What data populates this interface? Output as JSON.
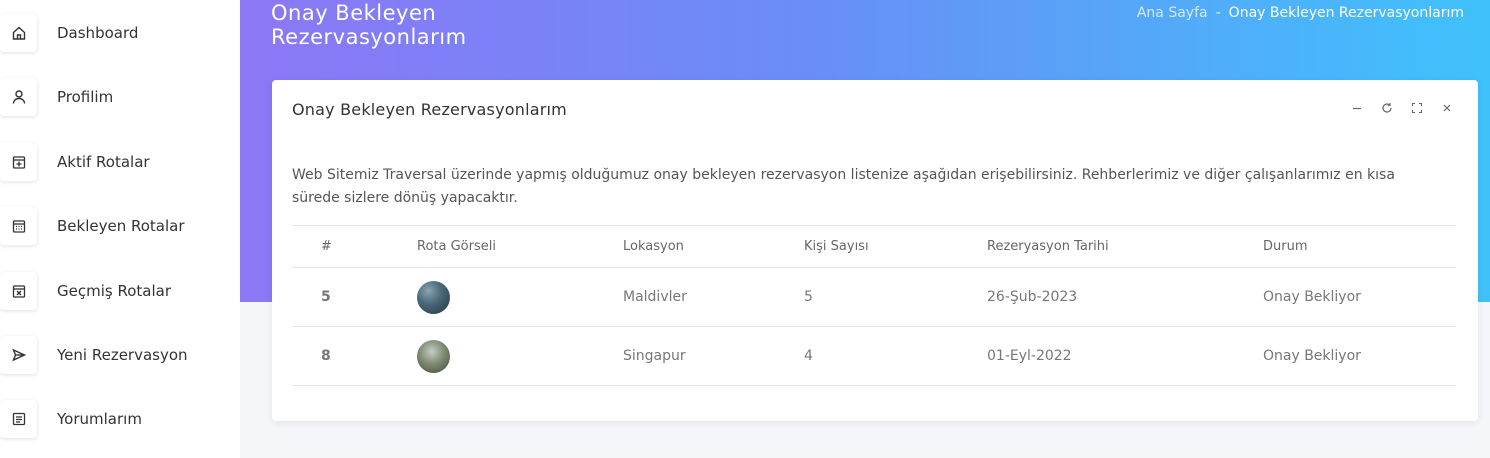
{
  "sidebar": {
    "items": [
      {
        "label": "Dashboard",
        "icon": "home-icon"
      },
      {
        "label": "Profilim",
        "icon": "user-icon"
      },
      {
        "label": "Aktif Rotalar",
        "icon": "calendar-plus-icon"
      },
      {
        "label": "Bekleyen Rotalar",
        "icon": "calendar-icon"
      },
      {
        "label": "Geçmiş Rotalar",
        "icon": "calendar-x-icon"
      },
      {
        "label": "Yeni Rezervasyon",
        "icon": "send-icon"
      },
      {
        "label": "Yorumlarım",
        "icon": "message-icon"
      }
    ]
  },
  "header": {
    "title": "Onay Bekleyen Rezervasyonlarım",
    "breadcrumb_home": "Ana Sayfa",
    "breadcrumb_sep": "-",
    "breadcrumb_current": "Onay Bekleyen Rezervasyonlarım"
  },
  "card": {
    "title": "Onay Bekleyen Rezervasyonlarım",
    "description": "Web Sitemiz Traversal üzerinde yapmış olduğumuz onay bekleyen rezervasyon listenize aşağıdan erişebilirsiniz. Rehberlerimiz ve diğer çalışanlarımız en kısa sürede sizlere dönüş yapacaktır.",
    "tools": [
      "minimize-icon",
      "refresh-icon",
      "fullscreen-icon",
      "close-icon"
    ]
  },
  "table": {
    "headers": [
      "#",
      "Rota Görseli",
      "Lokasyon",
      "Kişi Sayısı",
      "Rezeryasyon Tarihi",
      "Durum"
    ],
    "rows": [
      {
        "id": "5",
        "location": "Maldivler",
        "people": "5",
        "date": "26-Şub-2023",
        "status": "Onay Bekliyor"
      },
      {
        "id": "8",
        "location": "Singapur",
        "people": "4",
        "date": "01-Eyl-2022",
        "status": "Onay Bekliyor"
      }
    ]
  },
  "colors": {
    "gradient_start": "#8c77f5",
    "gradient_end": "#3fc2fb",
    "breadcrumb_current": "#ffffff"
  }
}
